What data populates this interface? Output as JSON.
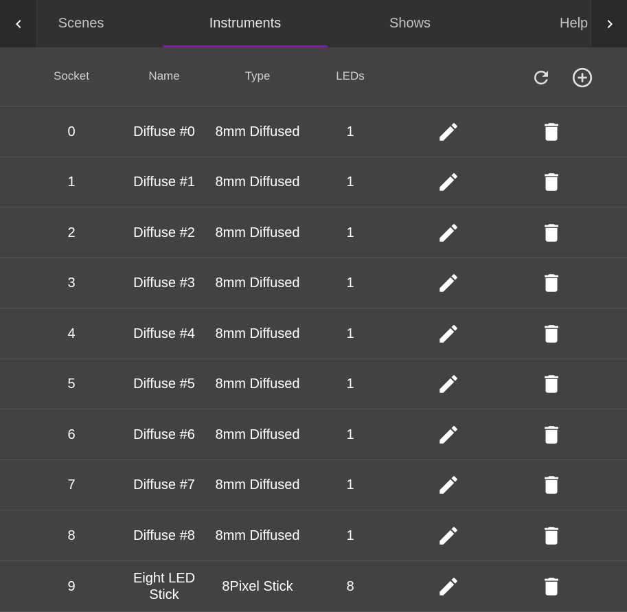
{
  "tabs": {
    "scenes": "Scenes",
    "instruments": "Instruments",
    "shows": "Shows",
    "help": "Help",
    "active": "Instruments",
    "accent_color": "#7b1fa2"
  },
  "nav": {
    "prev_icon": "chevron-left-icon",
    "next_icon": "chevron-right-icon"
  },
  "table": {
    "headers": {
      "socket": "Socket",
      "name": "Name",
      "type": "Type",
      "leds": "LEDs"
    },
    "header_actions": {
      "refresh_icon": "refresh-icon",
      "add_icon": "add-circle-icon"
    },
    "row_actions": {
      "edit_icon": "pencil-icon",
      "delete_icon": "trash-icon"
    },
    "rows": [
      {
        "socket": "0",
        "name": "Diffuse #0",
        "type": "8mm Diffused",
        "leds": "1"
      },
      {
        "socket": "1",
        "name": "Diffuse #1",
        "type": "8mm Diffused",
        "leds": "1"
      },
      {
        "socket": "2",
        "name": "Diffuse #2",
        "type": "8mm Diffused",
        "leds": "1"
      },
      {
        "socket": "3",
        "name": "Diffuse #3",
        "type": "8mm Diffused",
        "leds": "1"
      },
      {
        "socket": "4",
        "name": "Diffuse #4",
        "type": "8mm Diffused",
        "leds": "1"
      },
      {
        "socket": "5",
        "name": "Diffuse #5",
        "type": "8mm Diffused",
        "leds": "1"
      },
      {
        "socket": "6",
        "name": "Diffuse #6",
        "type": "8mm Diffused",
        "leds": "1"
      },
      {
        "socket": "7",
        "name": "Diffuse #7",
        "type": "8mm Diffused",
        "leds": "1"
      },
      {
        "socket": "8",
        "name": "Diffuse #8",
        "type": "8mm Diffused",
        "leds": "1"
      },
      {
        "socket": "9",
        "name": "Eight LED Stick",
        "type": "8Pixel Stick",
        "leds": "8"
      }
    ]
  },
  "colors": {
    "background": "#424242",
    "tabbar": "#313131",
    "divider": "#5a5a5a"
  }
}
